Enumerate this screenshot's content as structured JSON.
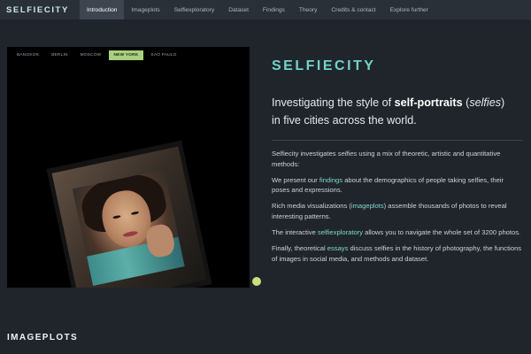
{
  "nav": {
    "brand": "SELFIECITY",
    "items": [
      {
        "label": "Introduction",
        "active": true
      },
      {
        "label": "Imageplots"
      },
      {
        "label": "Selfiexploratory"
      },
      {
        "label": "Dataset"
      },
      {
        "label": "Findings"
      },
      {
        "label": "Theory"
      },
      {
        "label": "Credits & contact"
      },
      {
        "label": "Explore further"
      }
    ]
  },
  "hero": {
    "cities": [
      "BANGKOK",
      "BERLIN",
      "MOSCOW",
      "NEW YORK",
      "SAO PAULO"
    ],
    "active_city": "NEW YORK"
  },
  "intro": {
    "title": "SELFIECITY",
    "lead_part1": "Investigating the style of ",
    "lead_bold": "self-portraits",
    "lead_part2": " (",
    "lead_italic": "selfies",
    "lead_part3": ")",
    "lead_line2": "in five cities across the world.",
    "p1_a": "Selfiecity investigates ",
    "p1_italic": "selfies",
    "p1_b": " using a mix of theoretic, artistic and quantitative methods:",
    "p2_a": "We present our ",
    "p2_link": "findings",
    "p2_b": " about the demographics of people taking selfies, their poses and expressions.",
    "p3_a": "Rich media visualizations (",
    "p3_link": "imageplots",
    "p3_b": ") assemble thousands of photos to reveal interesting patterns.",
    "p4_a": "The interactive ",
    "p4_link": "selfiexploratory",
    "p4_b": " allows you to navigate the whole set of 3200 photos.",
    "p5_a": "Finally, theoretical ",
    "p5_link": "essays",
    "p5_b": " discuss selfies in the history of photography, the functions of images in social media, and methods and dataset."
  },
  "section": {
    "title": "IMAGEPLOTS"
  },
  "colors": {
    "background": "#20252c",
    "nav_bg": "#2a3038",
    "accent_teal": "#72d3c6",
    "link": "#7fd9c7",
    "active_tab": "#a9d07f",
    "slider_dot": "#c8e27a"
  }
}
